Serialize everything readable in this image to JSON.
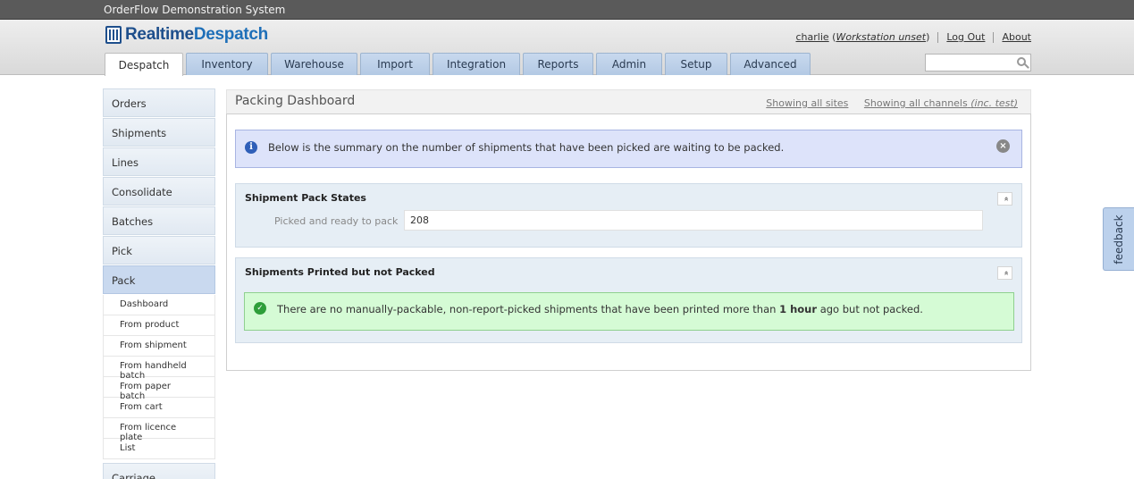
{
  "system_name": "OrderFlow Demonstration System",
  "logo": {
    "text_a": "Realtime",
    "text_b": "Despatch"
  },
  "user": {
    "name": "charlie",
    "workstation": "Workstation unset",
    "logout": "Log Out",
    "about": "About"
  },
  "tabs": [
    {
      "label": "Despatch",
      "active": true
    },
    {
      "label": "Inventory"
    },
    {
      "label": "Warehouse"
    },
    {
      "label": "Import"
    },
    {
      "label": "Integration"
    },
    {
      "label": "Reports"
    },
    {
      "label": "Admin"
    },
    {
      "label": "Setup"
    },
    {
      "label": "Advanced"
    }
  ],
  "search": {
    "placeholder": "",
    "value": ""
  },
  "sidebar": {
    "items": [
      "Orders",
      "Shipments",
      "Lines",
      "Consolidate",
      "Batches",
      "Pick",
      "Pack"
    ],
    "active": "Pack",
    "sub_items": [
      "Dashboard",
      "From product",
      "From shipment",
      "From handheld batch",
      "From paper batch",
      "From cart",
      "From licence plate",
      "List"
    ],
    "next_item": "Carriage"
  },
  "main": {
    "title": "Packing Dashboard",
    "scope_sites": "Showing all sites",
    "scope_channels": "Showing all channels",
    "scope_channels_note": "(inc. test)",
    "info_message": "Below is the summary on the number of shipments that have been picked are waiting to be packed.",
    "close_glyph": "×",
    "panel1": {
      "title": "Shipment Pack States",
      "collapse_glyph": "«",
      "row_label": "Picked and ready to pack",
      "row_value": "208"
    },
    "panel2": {
      "title": "Shipments Printed but not Packed",
      "collapse_glyph": "«",
      "msg_before": "There are no manually-packable, non-report-picked shipments that have been printed more than",
      "msg_bold": "1 hour",
      "msg_after": "ago but not packed."
    }
  },
  "feedback": "feedback",
  "colors": {
    "brand": "#1e4f8c",
    "tab": "#b3c9e4",
    "info_bg": "#dde3fa",
    "success_bg": "#d5fbd5"
  }
}
